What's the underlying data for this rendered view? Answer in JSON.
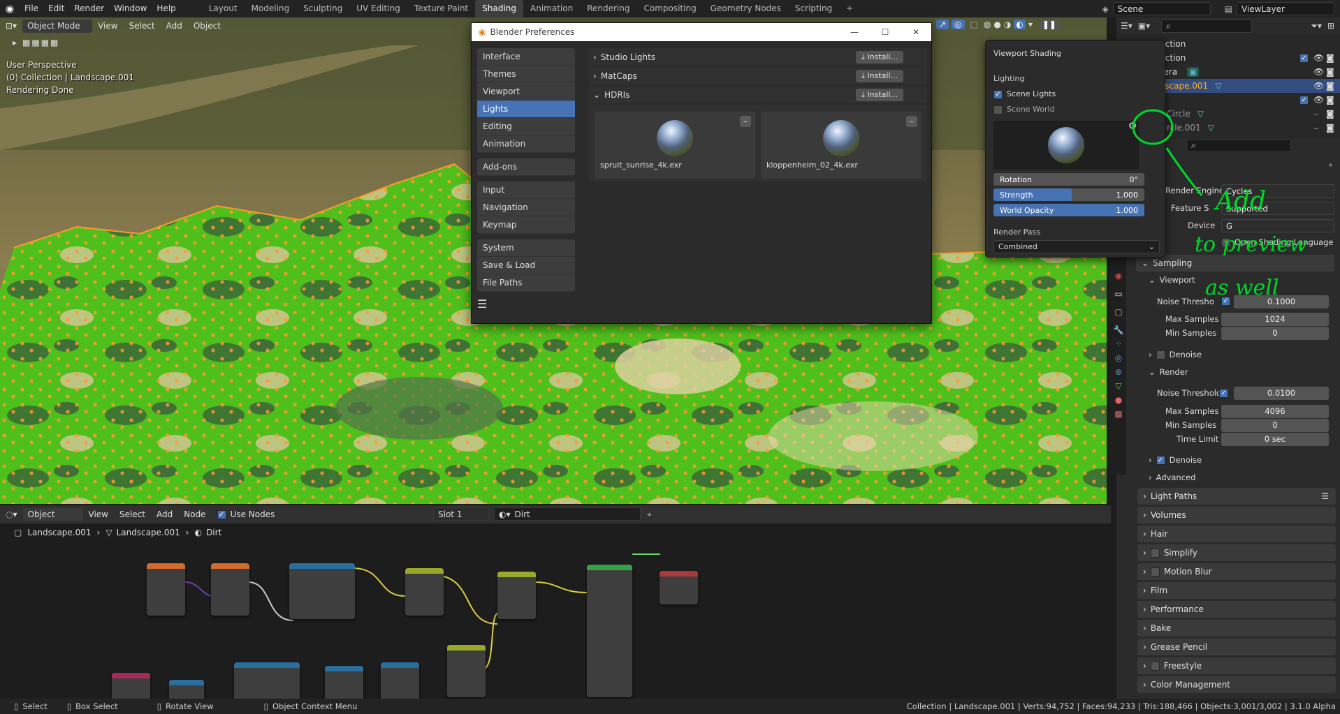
{
  "topbar": {
    "menus": [
      "File",
      "Edit",
      "Render",
      "Window",
      "Help"
    ],
    "workspaces": [
      "Layout",
      "Modeling",
      "Sculpting",
      "UV Editing",
      "Texture Paint",
      "Shading",
      "Animation",
      "Rendering",
      "Compositing",
      "Geometry Nodes",
      "Scripting"
    ],
    "active_workspace": "Shading",
    "scene": "Scene",
    "view_layer": "ViewLayer"
  },
  "viewport": {
    "mode": "Object Mode",
    "menus": [
      "View",
      "Select",
      "Add",
      "Object"
    ],
    "info_lines": [
      "User Perspective",
      "(0) Collection | Landscape.001",
      "Rendering Done"
    ]
  },
  "preferences": {
    "title": "Blender Preferences",
    "sidebar_groups": [
      [
        "Interface",
        "Themes",
        "Viewport",
        "Lights",
        "Editing",
        "Animation"
      ],
      [
        "Add-ons"
      ],
      [
        "Input",
        "Navigation",
        "Keymap"
      ],
      [
        "System",
        "Save & Load",
        "File Paths"
      ]
    ],
    "selected": "Lights",
    "sections": [
      {
        "label": "Studio Lights",
        "install": "Install..."
      },
      {
        "label": "MatCaps",
        "install": "Install..."
      },
      {
        "label": "HDRIs",
        "install": "Install..."
      }
    ],
    "hdris": [
      "spruit_sunrise_4k.exr",
      "kloppenheim_02_4k.exr"
    ]
  },
  "shading_popover": {
    "title": "Viewport Shading",
    "lighting_label": "Lighting",
    "scene_lights": "Scene Lights",
    "scene_lights_checked": true,
    "scene_world": "Scene World",
    "scene_world_checked": false,
    "rotation_label": "Rotation",
    "rotation_value": "0°",
    "strength_label": "Strength",
    "strength_value": "1.000",
    "world_opacity_label": "World Opacity",
    "world_opacity_value": "1.000",
    "render_pass_label": "Render Pass",
    "render_pass_value": "Combined"
  },
  "outliner": {
    "rows": [
      "Collection",
      "Collection",
      "Camera",
      "Landscape.001",
      "s",
      "Circle",
      "rcle.001"
    ]
  },
  "properties": {
    "render_engine_label": "Render Engine",
    "render_engine": "Cycles",
    "feature_set_label": "Feature S",
    "feature_set": "Supported",
    "device_label": "Device",
    "device": "G",
    "osl": "Open Shading Language",
    "sampling": "Sampling",
    "viewport": "Viewport",
    "viewport_noise_label": "Noise Thresho",
    "viewport_noise": "0.1000",
    "viewport_max_label": "Max Samples",
    "viewport_max": "1024",
    "viewport_min_label": "Min Samples",
    "viewport_min": "0",
    "denoise": "Denoise",
    "render": "Render",
    "render_noise_label": "Noise Threshold",
    "render_noise": "0.0100",
    "render_max_label": "Max Samples",
    "render_max": "4096",
    "render_min_label": "Min Samples",
    "render_min": "0",
    "time_limit_label": "Time Limit",
    "time_limit": "0 sec",
    "render_denoise": "Denoise",
    "advanced": "Advanced",
    "panels": [
      "Light Paths",
      "Volumes",
      "Hair",
      "Simplify",
      "Motion Blur",
      "Film",
      "Performance",
      "Bake",
      "Grease Pencil",
      "Freestyle",
      "Color Management"
    ]
  },
  "annotation": {
    "lines": [
      "Add",
      "to preview",
      "as well"
    ]
  },
  "node_editor": {
    "type": "Object",
    "menus": [
      "View",
      "Select",
      "Add",
      "Node"
    ],
    "use_nodes": "Use Nodes",
    "slot": "Slot 1",
    "material": "Dirt",
    "breadcrumb": [
      "Landscape.001",
      "Landscape.001",
      "Dirt"
    ]
  },
  "statusbar": {
    "select": "Select",
    "box_select": "Box Select",
    "rotate_view": "Rotate View",
    "context_menu": "Object Context Menu",
    "stats": "Collection | Landscape.001 | Verts:94,752 | Faces:94,233 | Tris:188,466 | Objects:3,001/3,002 | 3.1.0 Alpha"
  },
  "colors": {
    "accent": "#4772b3",
    "annotation": "#00d62a",
    "selection": "#ff9a2e"
  }
}
